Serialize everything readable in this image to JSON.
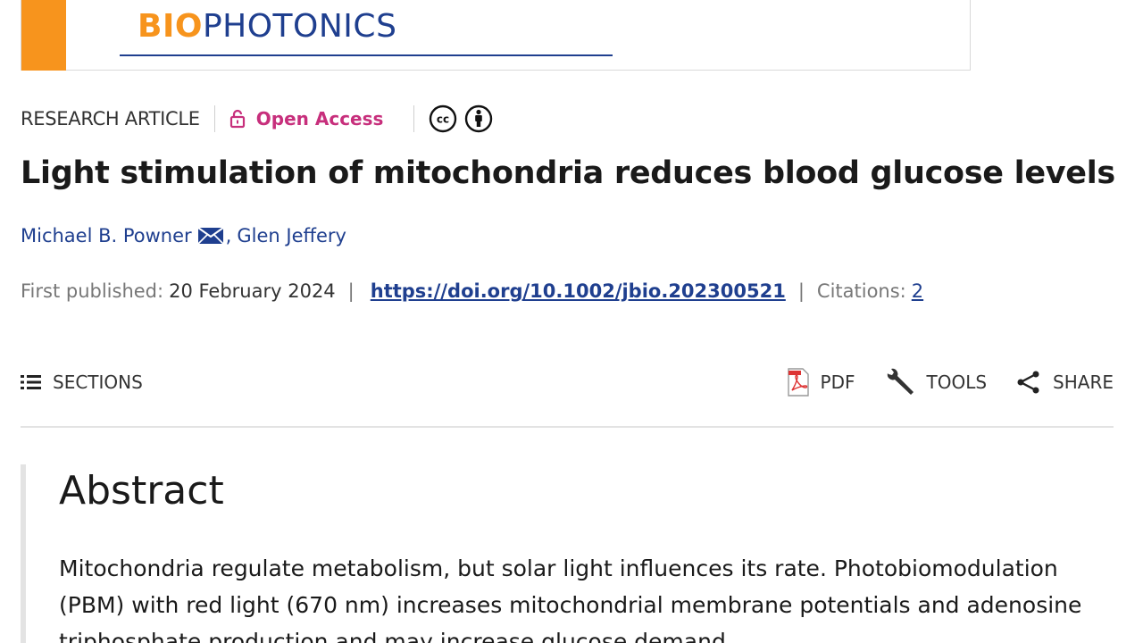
{
  "journal": {
    "name_part1": "BIO",
    "name_part2": "PHOTONICS",
    "colors": {
      "accent": "#f7941d",
      "brand": "#1f3f8f"
    }
  },
  "meta": {
    "article_type": "RESEARCH ARTICLE",
    "open_access_label": "Open Access",
    "open_access_icon": "unlocked-padlock-icon",
    "license_icons": [
      "creative-commons-icon",
      "attribution-icon"
    ],
    "open_access_color": "#c72f7c"
  },
  "title": "Light stimulation of mitochondria reduces blood glucose levels",
  "authors": [
    {
      "name": "Michael B. Powner",
      "corresponding": true
    },
    {
      "name": "Glen Jeffery",
      "corresponding": false
    }
  ],
  "author_separator": ",",
  "publication": {
    "first_published_label": "First published:",
    "first_published_date": "20 February 2024",
    "doi": "https://doi.org/10.1002/jbio.202300521",
    "citations_label": "Citations:",
    "citations_count": "2"
  },
  "toolbar": {
    "sections_label": "SECTIONS",
    "pdf_label": "PDF",
    "tools_label": "TOOLS",
    "share_label": "SHARE"
  },
  "abstract": {
    "heading": "Abstract",
    "text": "Mitochondria regulate metabolism, but solar light influences its rate. Photobiomodulation (PBM) with red light (670 nm) increases mitochondrial membrane potentials and adenosine triphosphate production and may increase glucose demand."
  }
}
